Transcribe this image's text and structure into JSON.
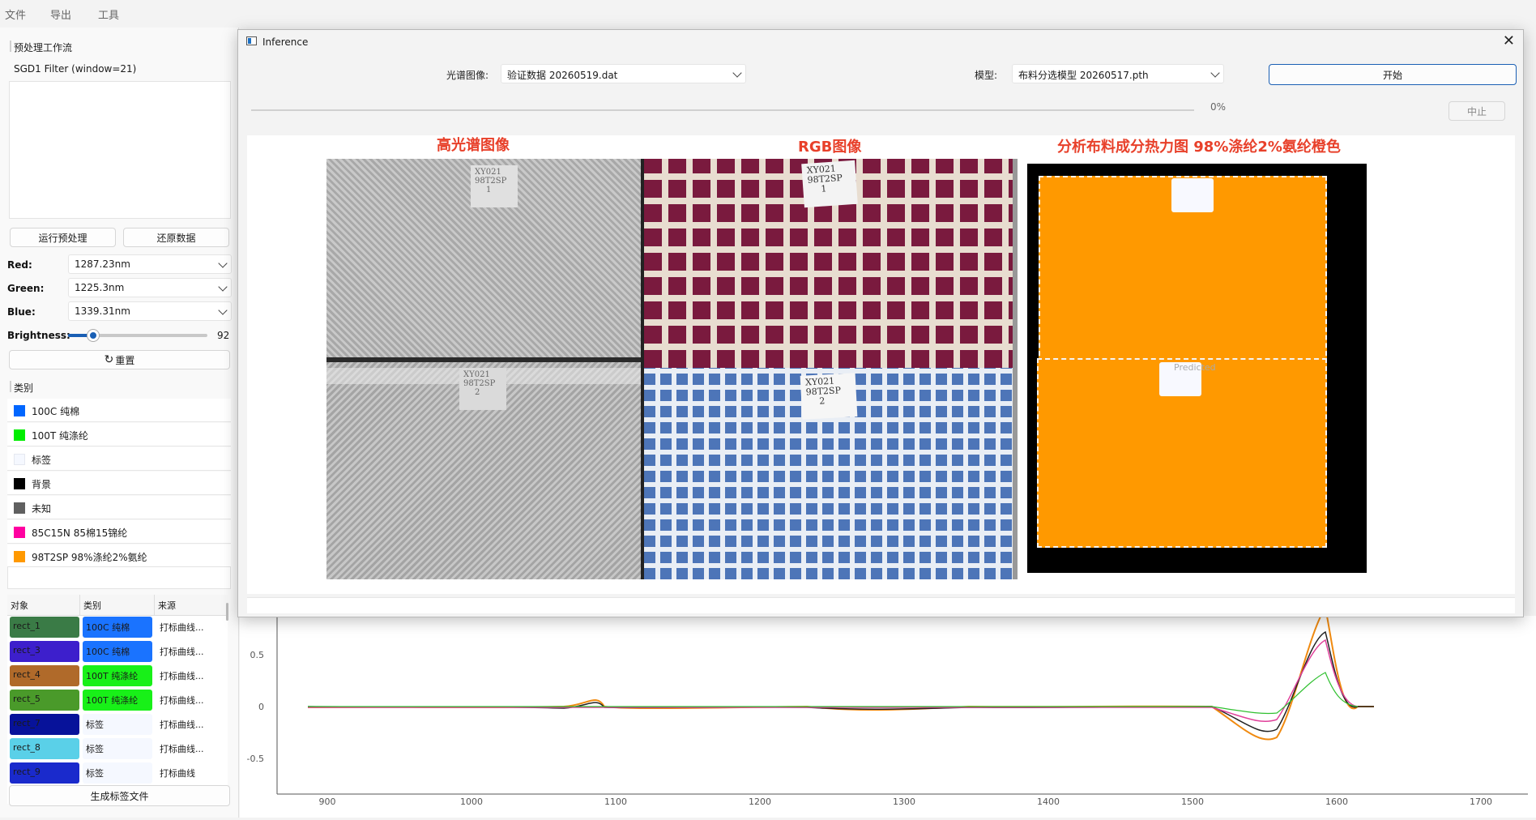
{
  "menu": [
    "文件",
    "导出",
    "工具"
  ],
  "left": {
    "workflow_title": "预处理工作流",
    "filter_text": "SGD1 Filter (window=21)",
    "run_btn": "运行预处理",
    "restore_btn": "还原数据",
    "red_label": "Red:",
    "red_value": "1287.23nm",
    "green_label": "Green:",
    "green_value": "1225.3nm",
    "blue_label": "Blue:",
    "blue_value": "1339.31nm",
    "brightness_label": "Brightness:",
    "brightness_value": "92",
    "reset_btn": "重置",
    "class_title": "类别",
    "classes": [
      {
        "label": "100C 纯棉",
        "color": "#0066ff"
      },
      {
        "label": "100T 纯涤纶",
        "color": "#00ee00"
      },
      {
        "label": "标签",
        "color": "#f5f8ff"
      },
      {
        "label": "背景",
        "color": "#000000"
      },
      {
        "label": "未知",
        "color": "#606060"
      },
      {
        "label": "85C15N 85棉15锦纶",
        "color": "#ff00a0"
      },
      {
        "label": "98T2SP 98%涤纶2%氨纶",
        "color": "#ff9900"
      }
    ],
    "table_headers": [
      "对象",
      "类别",
      "来源"
    ],
    "table_rows": [
      {
        "obj": "rect_1",
        "obj_color": "#3a7b46",
        "cls": "100C 纯棉",
        "cls_color": "#1a73ff",
        "src": "打标曲线..."
      },
      {
        "obj": "rect_3",
        "obj_color": "#3d1fcc",
        "cls": "100C 纯棉",
        "cls_color": "#1a73ff",
        "src": "打标曲线..."
      },
      {
        "obj": "rect_4",
        "obj_color": "#b06a2a",
        "cls": "100T 纯涤纶",
        "cls_color": "#18f018",
        "src": "打标曲线..."
      },
      {
        "obj": "rect_5",
        "obj_color": "#4a9a2a",
        "cls": "100T 纯涤纶",
        "cls_color": "#18f018",
        "src": "打标曲线..."
      },
      {
        "obj": "rect_7",
        "obj_color": "#07129a",
        "cls": "标签",
        "cls_color": "#f5f8ff",
        "src": "打标曲线..."
      },
      {
        "obj": "rect_8",
        "obj_color": "#5ad0e8",
        "cls": "标签",
        "cls_color": "#f5f8ff",
        "src": "打标曲线..."
      },
      {
        "obj": "rect_9",
        "obj_color": "#1a2acc",
        "cls": "标签",
        "cls_color": "#f5f8ff",
        "src": "打标曲线"
      }
    ],
    "gen_btn": "生成标签文件"
  },
  "dialog": {
    "title": "Inference",
    "spectral_label": "光谱图像:",
    "spectral_value": "验证数据 20260519.dat",
    "model_label": "模型:",
    "model_value": "布料分选模型 20260517.pth",
    "start_btn": "开始",
    "progress_text": "0%",
    "progress": 0,
    "stop_btn": "中止",
    "title_hsi": "高光谱图像",
    "title_rgb": "RGB图像",
    "title_heat": "分析布料成分热力图 98%涤纶2%氨纶橙色",
    "predicted_text": "Predicted",
    "tag_lines": [
      "XY021",
      "98T2SP",
      "1",
      "2"
    ]
  },
  "plot": {
    "yticks": [
      "0.5",
      "0",
      "-0.5"
    ],
    "xticks": [
      "900",
      "1000",
      "1100",
      "1200",
      "1300",
      "1400",
      "1500",
      "1600",
      "1700"
    ]
  }
}
